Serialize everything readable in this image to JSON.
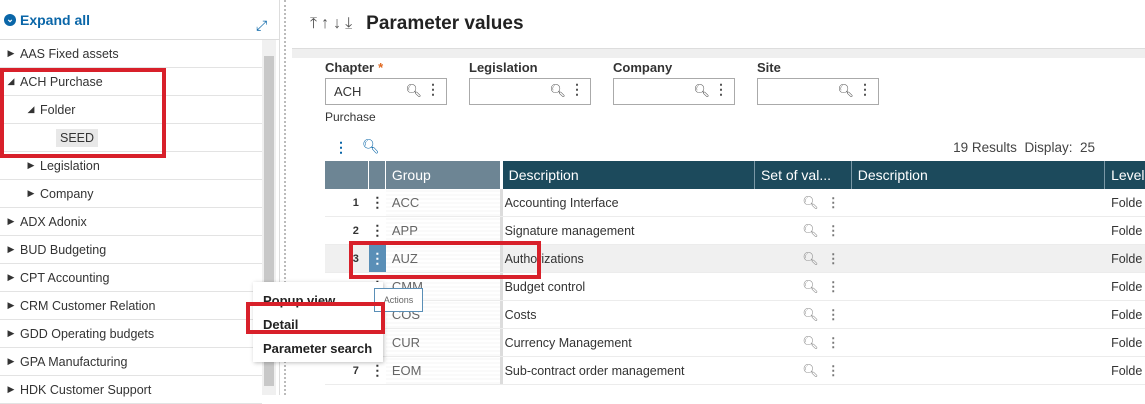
{
  "sidebar": {
    "expand_all": "Expand all",
    "items": [
      {
        "label": "AAS Fixed assets",
        "arrow": "▶",
        "indent": 0
      },
      {
        "label": "ACH Purchase",
        "arrow": "◢",
        "indent": 0
      },
      {
        "label": "Folder",
        "arrow": "◢",
        "indent": 1
      },
      {
        "label": "SEED",
        "arrow": "",
        "indent": 2
      },
      {
        "label": "Legislation",
        "arrow": "▶",
        "indent": 1
      },
      {
        "label": "Company",
        "arrow": "▶",
        "indent": 1
      },
      {
        "label": "ADX Adonix",
        "arrow": "▶",
        "indent": 0
      },
      {
        "label": "BUD Budgeting",
        "arrow": "▶",
        "indent": 0
      },
      {
        "label": "CPT Accounting",
        "arrow": "▶",
        "indent": 0
      },
      {
        "label": "CRM Customer Relation",
        "arrow": "▶",
        "indent": 0
      },
      {
        "label": "GDD Operating budgets",
        "arrow": "▶",
        "indent": 0
      },
      {
        "label": "GPA Manufacturing",
        "arrow": "▶",
        "indent": 0
      },
      {
        "label": "HDK Customer Support",
        "arrow": "▶",
        "indent": 0
      }
    ]
  },
  "header": {
    "title": "Parameter values",
    "nav": [
      "⤒",
      "↑",
      "↓",
      "⤓"
    ]
  },
  "filters": {
    "chapter_label": "Chapter",
    "chapter_required": "*",
    "chapter_value": "ACH",
    "chapter_desc": "Purchase",
    "legislation_label": "Legislation",
    "company_label": "Company",
    "site_label": "Site"
  },
  "results": {
    "text": "19 Results",
    "display_label": "Display:",
    "display_value": "25"
  },
  "grid": {
    "headers": [
      "Group",
      "Description",
      "Set of val...",
      "Description",
      "Level"
    ],
    "rows": [
      {
        "num": "1",
        "group": "ACC",
        "desc": "Accounting Interface",
        "level": "Folde"
      },
      {
        "num": "2",
        "group": "APP",
        "desc": "Signature management",
        "level": "Folde"
      },
      {
        "num": "3",
        "group": "AUZ",
        "desc": "Authorizations",
        "level": "Folde"
      },
      {
        "num": "",
        "group": "CMM",
        "desc": "Budget control",
        "level": "Folde"
      },
      {
        "num": "",
        "group": "COS",
        "desc": "Costs",
        "level": "Folde"
      },
      {
        "num": "",
        "group": "CUR",
        "desc": "Currency Management",
        "level": "Folde"
      },
      {
        "num": "7",
        "group": "EOM",
        "desc": "Sub-contract order management",
        "level": "Folde"
      }
    ]
  },
  "context_menu": {
    "items": [
      "Popup view",
      "Detail",
      "Parameter search"
    ],
    "tooltip": "Actions"
  },
  "colors": {
    "accent": "#0a66a8",
    "highlight_red": "#d8202a",
    "header_dark": "#1c4a5c",
    "header_gray": "#6d8594"
  }
}
